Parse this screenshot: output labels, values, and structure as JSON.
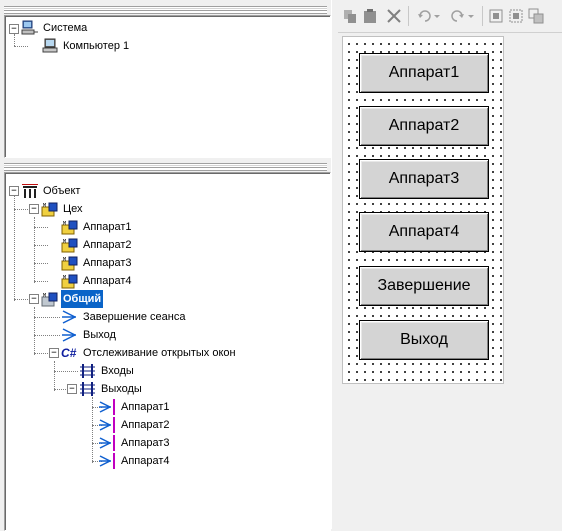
{
  "top_tree": {
    "root": "Система",
    "child": "Компьютер 1"
  },
  "bottom_tree": {
    "root": "Объект",
    "workshop": "Цех",
    "devices": [
      "Аппарат1",
      "Аппарат2",
      "Аппарат3",
      "Аппарат4"
    ],
    "common": "Общий",
    "end_session": "Завершение сеанса",
    "exit": "Выход",
    "tracking": "Отслеживание открытых окон",
    "csharp_badge": "C#",
    "inputs": "Входы",
    "outputs": "Выходы",
    "output_items": [
      "Аппарат1",
      "Аппарат2",
      "Аппарат3",
      "Аппарат4"
    ]
  },
  "toolbar": {
    "icons": [
      "copy-icon",
      "paste-icon",
      "cut-icon",
      "undo-icon",
      "redo-icon",
      "align-icon",
      "group-icon",
      "order-icon"
    ]
  },
  "form": {
    "buttons": [
      "Аппарат1",
      "Аппарат2",
      "Аппарат3",
      "Аппарат4",
      "Завершение",
      "Выход"
    ]
  }
}
